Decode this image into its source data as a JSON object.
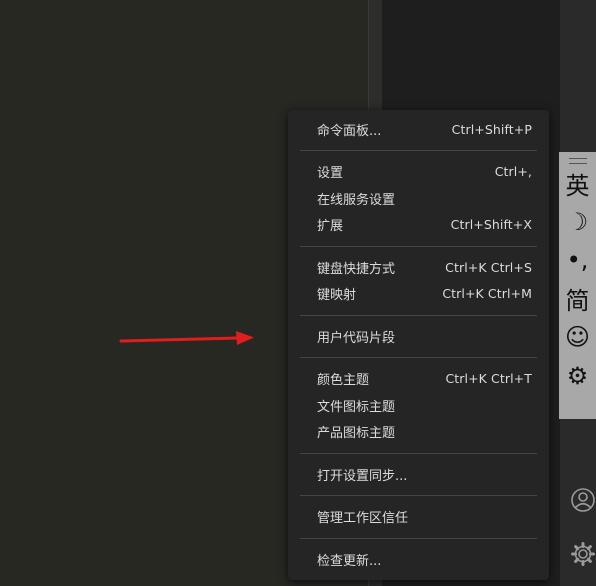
{
  "menu": {
    "groups": [
      [
        {
          "label": "命令面板...",
          "shortcut": "Ctrl+Shift+P"
        }
      ],
      [
        {
          "label": "设置",
          "shortcut": "Ctrl+,"
        },
        {
          "label": "在线服务设置",
          "shortcut": ""
        },
        {
          "label": "扩展",
          "shortcut": "Ctrl+Shift+X"
        }
      ],
      [
        {
          "label": "键盘快捷方式",
          "shortcut": "Ctrl+K Ctrl+S"
        },
        {
          "label": "键映射",
          "shortcut": "Ctrl+K Ctrl+M"
        }
      ],
      [
        {
          "label": "用户代码片段",
          "shortcut": ""
        }
      ],
      [
        {
          "label": "颜色主题",
          "shortcut": "Ctrl+K Ctrl+T"
        },
        {
          "label": "文件图标主题",
          "shortcut": ""
        },
        {
          "label": "产品图标主题",
          "shortcut": ""
        }
      ],
      [
        {
          "label": "打开设置同步...",
          "shortcut": ""
        }
      ],
      [
        {
          "label": "管理工作区信任",
          "shortcut": ""
        }
      ],
      [
        {
          "label": "检查更新...",
          "shortcut": ""
        }
      ]
    ]
  },
  "ime_toolbar": {
    "buttons": [
      {
        "label": "英",
        "icon": "english-mode-icon"
      },
      {
        "label": "☽",
        "icon": "moon-icon"
      },
      {
        "label": "•,",
        "icon": "punctuation-icon"
      },
      {
        "label": "简",
        "icon": "simplified-chinese-icon"
      },
      {
        "label": "☺",
        "icon": "emoji-icon"
      },
      {
        "label": "⚙",
        "icon": "ime-settings-icon"
      }
    ]
  },
  "activity_bar": {
    "icons": [
      "account-icon",
      "manage-gear-icon"
    ]
  },
  "colors": {
    "editor_bg": "#272822",
    "menu_bg": "#252526",
    "arrow": "#e01e1e"
  }
}
